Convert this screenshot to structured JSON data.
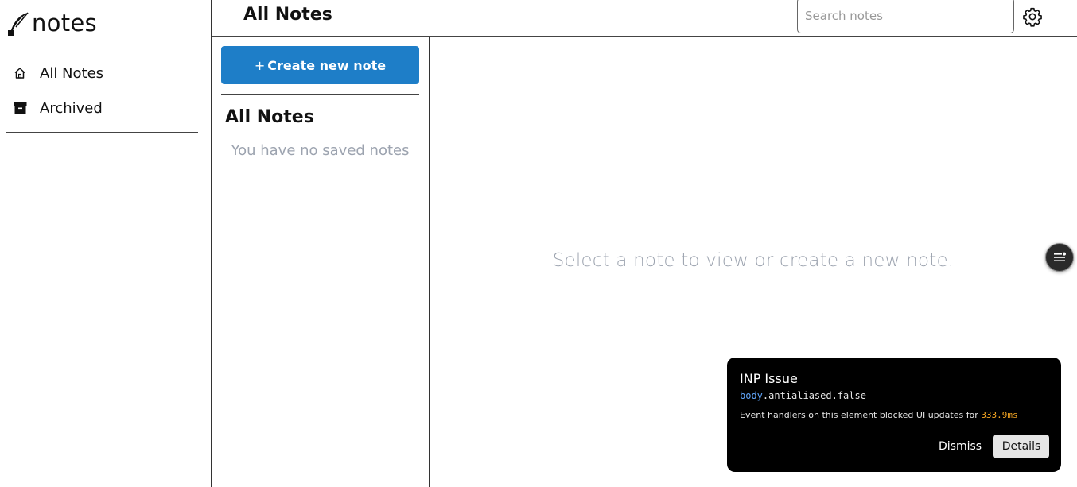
{
  "app": {
    "logo_text": "notes",
    "logo_icon": "quill-icon"
  },
  "sidebar": {
    "items": [
      {
        "label": "All Notes",
        "icon": "home-icon"
      },
      {
        "label": "Archived",
        "icon": "archive-icon"
      }
    ]
  },
  "header": {
    "title": "All Notes",
    "search_placeholder": "Search notes",
    "search_value": "",
    "settings_icon": "gear-icon"
  },
  "list": {
    "create_button_plus": "+",
    "create_button_label": "Create new note",
    "title": "All Notes",
    "empty_message": "You have no saved notes"
  },
  "main": {
    "empty_message": "Select a note to view or create a new note."
  },
  "toast": {
    "title": "INP Issue",
    "code_tag": "body",
    "code_rest": ".antialiased.false",
    "description": "Event handlers on this element blocked UI updates for ",
    "duration": "333.9ms",
    "dismiss_label": "Dismiss",
    "details_label": "Details"
  },
  "colors": {
    "primary": "#1e7ec8",
    "muted_text": "#9ca3af",
    "toast_bg": "#000000",
    "duration_accent": "#f5a623",
    "code_tag": "#60a5fa"
  }
}
